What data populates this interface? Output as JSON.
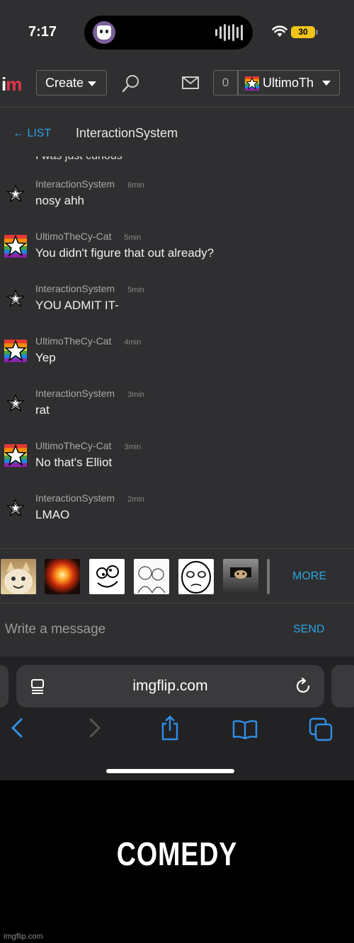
{
  "status": {
    "time": "7:17",
    "battery": "30"
  },
  "nav": {
    "logo_main": "i",
    "logo_rest": "m",
    "create_label": "Create",
    "notif_count": "0",
    "username": "UltimoTh"
  },
  "conversation": {
    "back_label": "← LIST",
    "title": "InteractionSystem",
    "partial_line": "I was just curious"
  },
  "messages": [
    {
      "author": "InteractionSystem",
      "ago": "6min",
      "text": "nosy ahh",
      "avatar": "star"
    },
    {
      "author": "UltimoTheCy-Cat",
      "ago": "5min",
      "text": "You didn't figure that out already?",
      "avatar": "rainbow-star"
    },
    {
      "author": "InteractionSystem",
      "ago": "5min",
      "text": "YOU ADMIT IT-",
      "avatar": "star"
    },
    {
      "author": "UltimoTheCy-Cat",
      "ago": "4min",
      "text": "Yep",
      "avatar": "rainbow-star"
    },
    {
      "author": "InteractionSystem",
      "ago": "3min",
      "text": "rat",
      "avatar": "star"
    },
    {
      "author": "UltimoTheCy-Cat",
      "ago": "3min",
      "text": "No that's Elliot",
      "avatar": "rainbow-star"
    },
    {
      "author": "InteractionSystem",
      "ago": "2min",
      "text": "LMAO",
      "avatar": "star"
    }
  ],
  "meme_strip": {
    "thumbnails": [
      "happy-cat-meme",
      "explosion-meme",
      "derp-face-meme",
      "sketch-meme",
      "okay-face-meme",
      "ceiling-cat-meme"
    ],
    "more_label": "MORE"
  },
  "compose": {
    "placeholder": "Write a message",
    "send_label": "SEND"
  },
  "browser": {
    "url": "imgflip.com"
  },
  "caption": "COMEDY",
  "watermark": "imgflip.com",
  "colors": {
    "accent": "#2aa4e0",
    "logo": "#e8344a",
    "background": "#2f2f31"
  }
}
